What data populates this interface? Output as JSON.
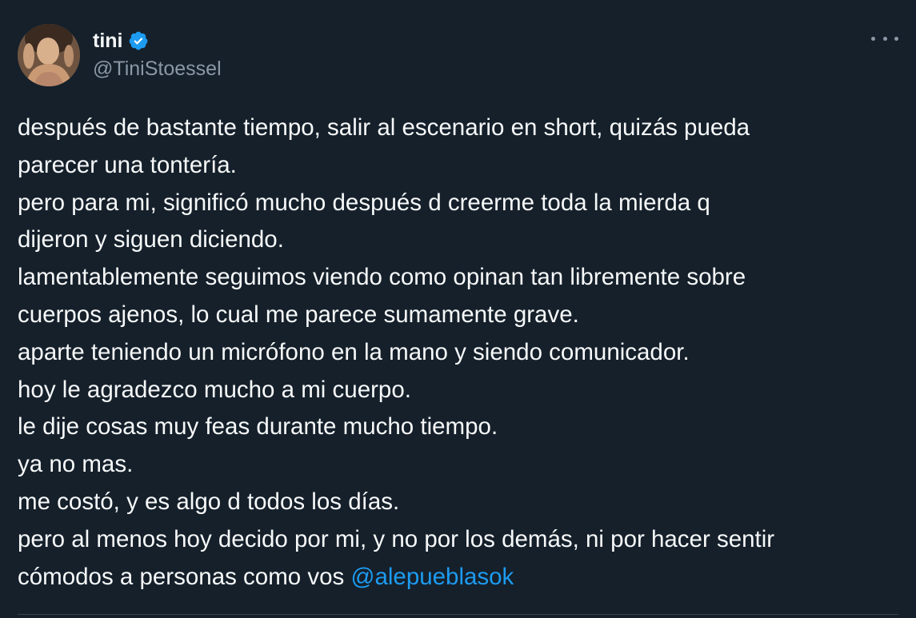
{
  "user": {
    "display_name": "tini",
    "handle": "@TiniStoessel",
    "verified": true
  },
  "tweet": {
    "lines": [
      "después de bastante tiempo, salir al escenario en short, quizás pueda",
      "parecer una tontería.",
      "pero para mi, significó mucho después d creerme toda la mierda q",
      "dijeron y siguen diciendo.",
      "lamentablemente seguimos viendo como opinan tan libremente sobre",
      "cuerpos ajenos, lo cual me parece sumamente grave.",
      "aparte teniendo un micrófono en la mano y siendo comunicador.",
      "hoy le agradezco mucho a mi cuerpo.",
      "le dije cosas muy feas durante mucho tiempo.",
      "ya no mas.",
      "me costó, y es algo d todos los días.",
      "pero al menos hoy decido por mi, y no por los demás, ni por hacer sentir"
    ],
    "last_line_text": "cómodos a personas como vos ",
    "mention": "@alepueblasok"
  },
  "icons": {
    "verified": "verified-badge-icon",
    "more": "more-options-icon"
  },
  "colors": {
    "background": "#15202b",
    "text": "#f7f9f9",
    "secondary_text": "#8b98a5",
    "accent": "#1d9bf0"
  }
}
